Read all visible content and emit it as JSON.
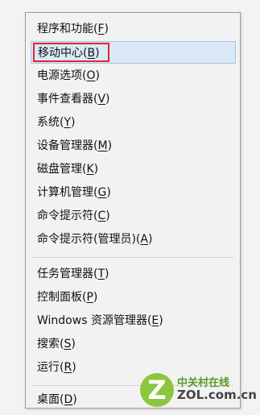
{
  "menu": {
    "items": [
      {
        "label": "程序和功能(F)",
        "before": "程序和功能(",
        "key": "F",
        "after": ")"
      },
      {
        "label": "移动中心(B)",
        "before": "移动中心(",
        "key": "B",
        "after": ")",
        "highlighted": true
      },
      {
        "label": "电源选项(O)",
        "before": "电源选项(",
        "key": "O",
        "after": ")"
      },
      {
        "label": "事件查看器(V)",
        "before": "事件查看器(",
        "key": "V",
        "after": ")"
      },
      {
        "label": "系统(Y)",
        "before": "系统(",
        "key": "Y",
        "after": ")"
      },
      {
        "label": "设备管理器(M)",
        "before": "设备管理器(",
        "key": "M",
        "after": ")"
      },
      {
        "label": "磁盘管理(K)",
        "before": "磁盘管理(",
        "key": "K",
        "after": ")"
      },
      {
        "label": "计算机管理(G)",
        "before": "计算机管理(",
        "key": "G",
        "after": ")"
      },
      {
        "label": "命令提示符(C)",
        "before": "命令提示符(",
        "key": "C",
        "after": ")"
      },
      {
        "label": "命令提示符(管理员)(A)",
        "before": "命令提示符(管理员)(",
        "key": "A",
        "after": ")"
      },
      {
        "label": "任务管理器(T)",
        "before": "任务管理器(",
        "key": "T",
        "after": ")"
      },
      {
        "label": "控制面板(P)",
        "before": "控制面板(",
        "key": "P",
        "after": ")"
      },
      {
        "label": "Windows 资源管理器(E)",
        "before": "Windows 资源管理器(",
        "key": "E",
        "after": ")"
      },
      {
        "label": "搜索(S)",
        "before": "搜索(",
        "key": "S",
        "after": ")"
      },
      {
        "label": "运行(R)",
        "before": "运行(",
        "key": "R",
        "after": ")"
      },
      {
        "label": "桌面(D)",
        "before": "桌面(",
        "key": "D",
        "after": ")"
      }
    ]
  },
  "watermark": {
    "logo_letter": "Z",
    "name": "中关村在线",
    "domain": "ZOL.com.cn"
  },
  "colors": {
    "highlight_bg": "#dbe8f7",
    "highlight_border": "#a9c4e6",
    "annotation_red": "#e0282c",
    "logo_green": "#8cc63f"
  }
}
